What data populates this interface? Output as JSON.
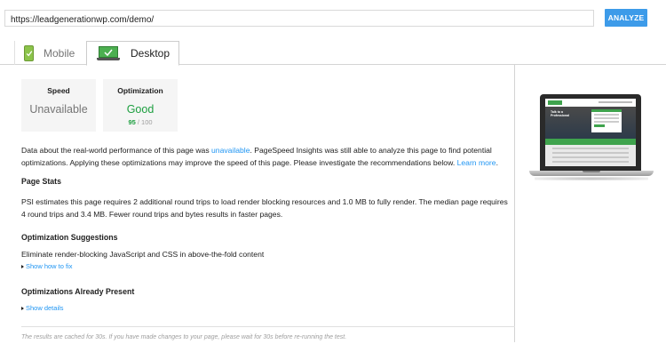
{
  "search": {
    "url_value": "https://leadgenerationwp.com/demo/",
    "analyze_label": "ANALYZE"
  },
  "tabs": [
    {
      "label": "Mobile",
      "icon": "mobile-phone-icon",
      "active": false
    },
    {
      "label": "Desktop",
      "icon": "desktop-monitor-icon",
      "active": true
    }
  ],
  "scores": {
    "speed": {
      "label": "Speed",
      "value": "Unavailable"
    },
    "optimization": {
      "label": "Optimization",
      "value": "Good",
      "score": "95",
      "score_suffix": " / 100"
    }
  },
  "intro": {
    "text_before": "Data about the real-world performance of this page was ",
    "unavailable_link": "unavailable",
    "text_after": ". PageSpeed Insights was still able to analyze this page to find potential optimizations. Applying these optimizations may improve the speed of this page. Please investigate the recommendations below. ",
    "learn_more_link": "Learn more",
    "end": "."
  },
  "page_stats": {
    "heading": "Page Stats",
    "text": "PSI estimates this page requires 2 additional round trips to load render blocking resources and 1.0 MB to fully render. The median page requires 4 round trips and 3.4 MB. Fewer round trips and bytes results in faster pages."
  },
  "suggestions": {
    "heading": "Optimization Suggestions",
    "item": "Eliminate render-blocking JavaScript and CSS in above-the-fold content",
    "toggle": "Show how to fix"
  },
  "already_present": {
    "heading": "Optimizations Already Present",
    "toggle": "Show details"
  },
  "footer": {
    "note": "The results are cached for 30s. If you have made changes to your page, please wait for 30s before re-running the test."
  },
  "preview": {
    "hero_text_line1": "Talk to a",
    "hero_text_line2": "Professional"
  },
  "colors": {
    "accent": "#3d9be9",
    "good": "#1b9e3e",
    "link": "#2196f3"
  }
}
